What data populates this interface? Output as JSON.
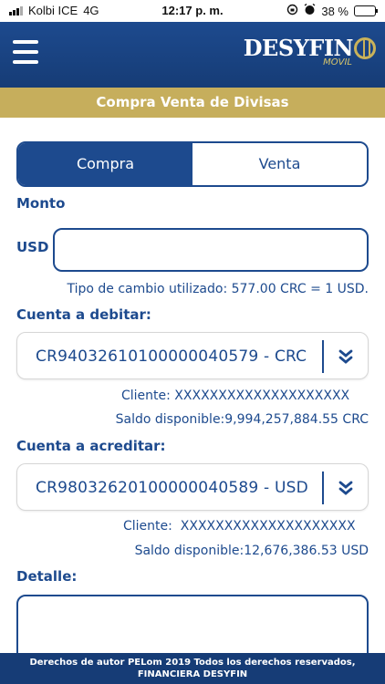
{
  "status_bar": {
    "carrier": "Kolbi ICE",
    "network": "4G",
    "time": "12:17 p. m.",
    "battery": "38 %",
    "battery_level": 0.38
  },
  "header": {
    "brand": "DESYFIN",
    "sub_brand": "MOVIL"
  },
  "title": "Compra Venta de Divisas",
  "tabs": [
    {
      "label": "Compra",
      "active": true
    },
    {
      "label": "Venta",
      "active": false
    }
  ],
  "monto": {
    "label": "Monto",
    "currency_label": "USD",
    "value": "",
    "placeholder": ""
  },
  "exchange_rate_text": "Tipo de cambio utilizado: 577.00 CRC = 1 USD.",
  "debit": {
    "label": "Cuenta a debitar:",
    "account": "CR94032610100000040579 - CRC",
    "client": "Cliente: XXXXXXXXXXXXXXXXXXXX",
    "balance": "Saldo disponible:9,994,257,884.55 CRC"
  },
  "credit": {
    "label": "Cuenta a acreditar:",
    "account": "CR98032620100000040589 - USD",
    "client": "Cliente:  XXXXXXXXXXXXXXXXXXXX",
    "balance": "Saldo disponible:12,676,386.53 USD"
  },
  "detail": {
    "label": "Detalle:",
    "value": ""
  },
  "footer": {
    "line1": "Derechos de autor PELom 2019 Todos los derechos reservados,",
    "line2": "FINANCIERA DESYFIN"
  },
  "icons": {
    "menu": "hamburger-menu-icon",
    "dropdown": "double-chevron-down-icon"
  },
  "colors": {
    "primary": "#1d4a8e",
    "gold": "#c6ae5c",
    "footer": "#163c76"
  }
}
